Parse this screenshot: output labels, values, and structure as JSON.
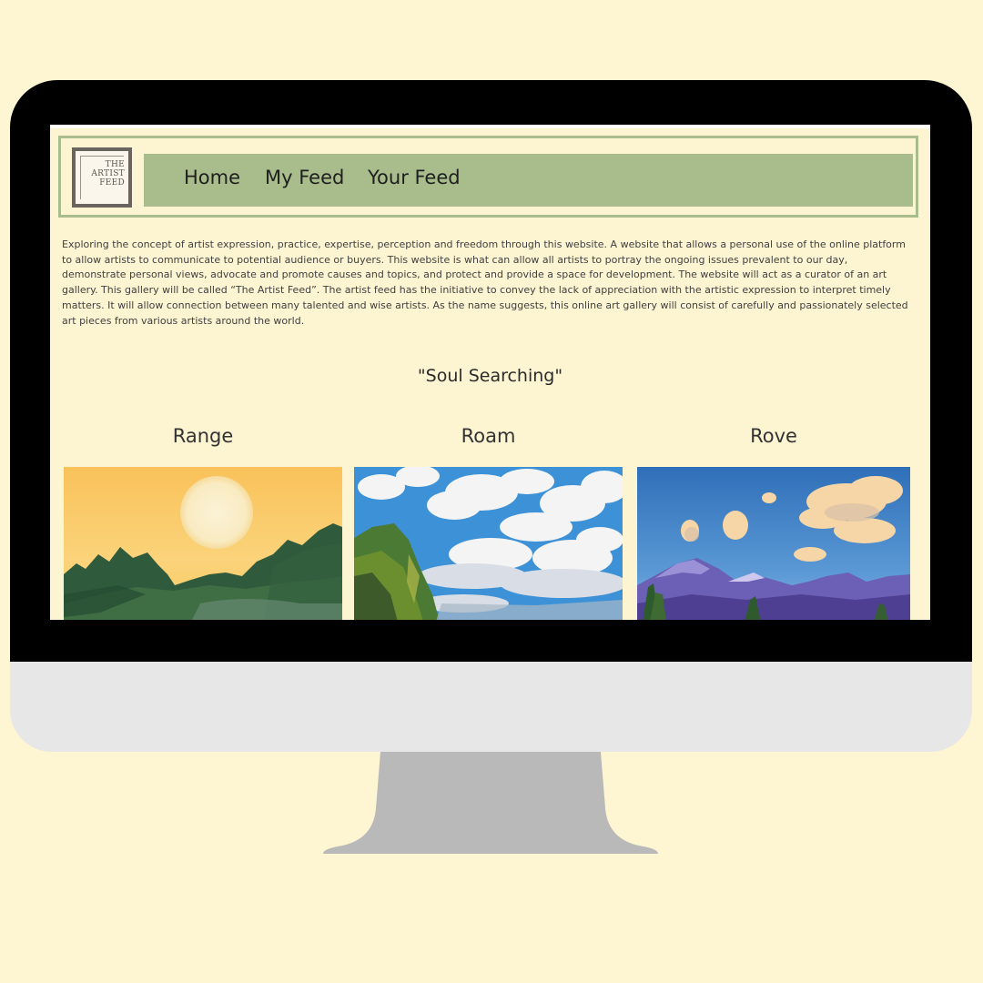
{
  "site": {
    "logo_lines": [
      "THE",
      "ARTIST",
      "FEED"
    ],
    "nav": [
      {
        "label": "Home"
      },
      {
        "label": "My Feed"
      },
      {
        "label": "Your Feed"
      }
    ]
  },
  "intro_text": "Exploring the concept of artist expression, practice, expertise, perception and freedom through this website. A website that allows a personal use of the online platform to allow artists to communicate to potential audience or buyers. This website is what can allow all artists to portray the ongoing issues prevalent to our day, demonstrate personal views, advocate and promote causes and topics, and protect and provide a space for development. The website will act as a curator of an art gallery. This gallery will be called “The Artist Feed”. The artist feed has the initiative to convey the lack of appreciation with the artistic expression to interpret timely matters. It will allow connection between many talented and wise artists. As the name suggests, this online art gallery will consist of carefully and passionately selected art pieces from various artists around the world.",
  "gallery": {
    "title": "\"Soul Searching\"",
    "artworks": [
      {
        "title": "Range"
      },
      {
        "title": "Roam"
      },
      {
        "title": "Rove"
      }
    ]
  },
  "colors": {
    "background": "#fef5d2",
    "nav_green": "#a8bd8b",
    "bezel": "#000000",
    "chin": "#e7e7e7",
    "stand": "#b9b9b9"
  }
}
